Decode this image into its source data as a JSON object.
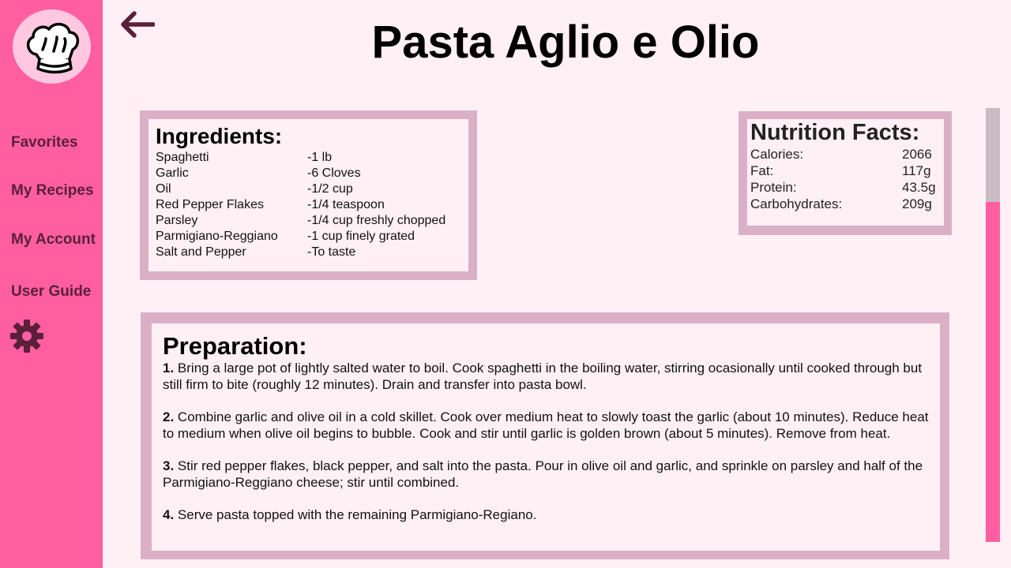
{
  "sidebar": {
    "logo_icon": "chef-hat-icon",
    "items": [
      {
        "label": "Favorites"
      },
      {
        "label": "My Recipes"
      },
      {
        "label": "My Account"
      },
      {
        "label": "User Guide"
      }
    ],
    "settings_icon": "gear-icon",
    "bg_color": "#ff5fa0",
    "text_color": "#5a1f3a"
  },
  "header": {
    "back_icon": "back-arrow-icon",
    "title": "Pasta Aglio e Olio"
  },
  "ingredients": {
    "heading": "Ingredients:",
    "items": [
      {
        "name": "Spaghetti",
        "amount": "-1 lb"
      },
      {
        "name": "Garlic",
        "amount": "-6 Cloves"
      },
      {
        "name": "Oil",
        "amount": "-1/2 cup"
      },
      {
        "name": "Red Pepper Flakes",
        "amount": "-1/4 teaspoon"
      },
      {
        "name": "Parsley",
        "amount": "-1/4 cup freshly chopped"
      },
      {
        "name": "Parmigiano-Reggiano",
        "amount": "-1 cup finely grated"
      },
      {
        "name": "Salt and Pepper",
        "amount": "-To taste"
      }
    ]
  },
  "nutrition": {
    "heading": "Nutrition Facts:",
    "items": [
      {
        "name": "Calories:",
        "value": "2066"
      },
      {
        "name": "Fat:",
        "value": "117g"
      },
      {
        "name": "Protein:",
        "value": "43.5g"
      },
      {
        "name": "Carbohydrates:",
        "value": "209g"
      }
    ]
  },
  "preparation": {
    "heading": "Preparation:",
    "steps": [
      {
        "num": "1.",
        "text": " Bring a large pot of lightly salted water to boil. Cook spaghetti in the boiling water, stirring ocasionally until cooked through but still firm to bite (roughly 12 minutes). Drain and transfer into pasta bowl."
      },
      {
        "num": "2.",
        "text": " Combine garlic and olive oil in a cold skillet. Cook over medium heat to slowly toast the garlic (about 10 minutes). Reduce heat to medium when olive oil begins to bubble. Cook and stir until garlic is golden brown (about 5 minutes). Remove from heat."
      },
      {
        "num": "3.",
        "text": " Stir red pepper flakes, black pepper, and salt into the pasta. Pour in olive oil and garlic, and sprinkle on parsley and half of the Parmigiano-Reggiano cheese; stir until combined."
      },
      {
        "num": "4.",
        "text": " Serve pasta topped with the remaining Parmigiano-Regiano."
      }
    ]
  },
  "colors": {
    "accent": "#ff5fa0",
    "box_border": "#dbb0c6",
    "background": "#fff0f5",
    "scroll_thumb": "#c8bcc2"
  }
}
